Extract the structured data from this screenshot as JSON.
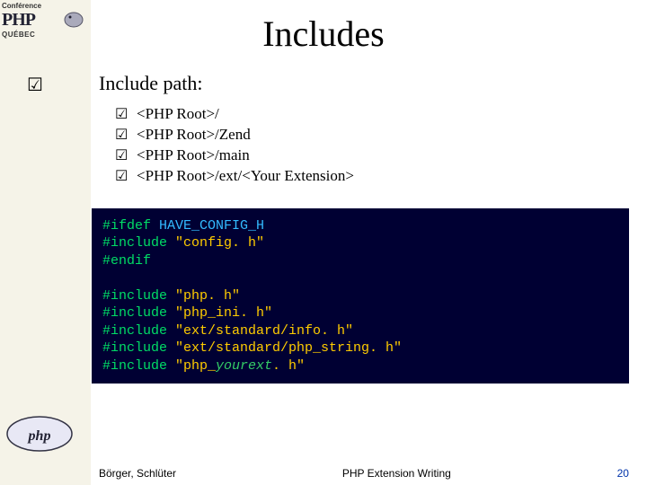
{
  "logo": {
    "conference_label": "Conférence",
    "php_text": "PHP",
    "quebec": "QUÉBEC"
  },
  "title": "Includes",
  "section": {
    "heading": "Include path:",
    "paths": [
      "<PHP Root>/",
      "<PHP Root>/Zend",
      "<PHP Root>/main",
      "<PHP Root>/ext/<Your Extension>"
    ]
  },
  "code": {
    "l1_kw": "#ifdef ",
    "l1_macro": "HAVE_CONFIG_H",
    "l2_kw": "#include ",
    "l2_str": "\"config. h\"",
    "l3_kw": "#endif",
    "inc_kw": "#include ",
    "inc1": "\"php. h\"",
    "inc2": "\"php_ini. h\"",
    "inc3": "\"ext/standard/info. h\"",
    "inc4": "\"ext/standard/php_string. h\"",
    "inc5a": "\"php_",
    "inc5b": "yourext",
    "inc5c": ". h\""
  },
  "footer": {
    "authors": "Börger, Schlüter",
    "title": "PHP Extension Writing",
    "page": "20"
  },
  "checkmark": "☑"
}
